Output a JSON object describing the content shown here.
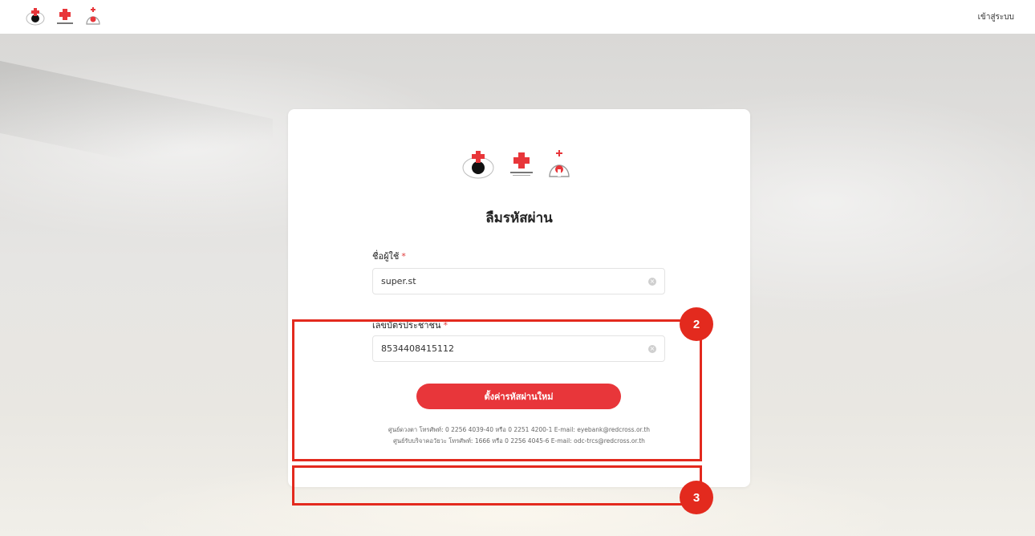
{
  "topbar": {
    "login_link": "เข้าสู่ระบบ"
  },
  "card": {
    "title": "ลืมรหัสผ่าน",
    "username": {
      "label": "ชื่อผู้ใช้",
      "required_mark": "*",
      "value": "super.st"
    },
    "national_id": {
      "label": "เลขบัตรประชาชน",
      "required_mark": "*",
      "value": "8534408415112"
    },
    "submit_label": "ตั้งค่ารหัสผ่านใหม่",
    "contact_lines": [
      "ศูนย์ดวงตา โทรศัพท์: 0 2256 4039-40 หรือ 0 2251 4200-1 E-mail: eyebank@redcross.or.th",
      "ศูนย์รับบริจาคอวัยวะ โทรศัพท์: 1666 หรือ 0 2256 4045-6 E-mail: odc-trcs@redcross.or.th"
    ]
  },
  "annotations": {
    "badge_2": "2",
    "badge_3": "3"
  },
  "colors": {
    "accent": "#e8363a",
    "annotation": "#e32a1e"
  },
  "icons": [
    "eye-bank-logo-icon",
    "red-cross-logo-icon",
    "organ-donation-logo-icon",
    "clear-icon"
  ]
}
